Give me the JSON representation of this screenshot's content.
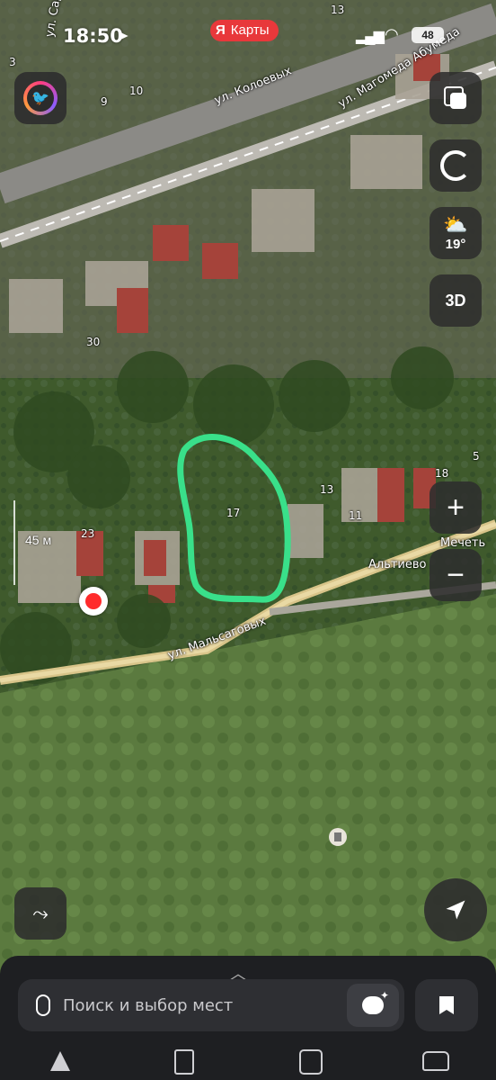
{
  "status_bar": {
    "time": "18:50",
    "battery": "48"
  },
  "app": {
    "brand_logo": "Я",
    "brand_name": "Карты"
  },
  "map": {
    "streets": [
      "ул. Садовая",
      "ул. Колоевых",
      "ул. Магомеда Абумеда",
      "ул. Мальсаговых"
    ],
    "house_numbers": [
      "3",
      "9",
      "10",
      "13",
      "30",
      "17",
      "23",
      "13",
      "11",
      "18",
      "5"
    ],
    "place_label_partial": "Альтиево",
    "poi_label_partial": "Мечеть",
    "scale_label": "45 м",
    "highlight_color": "#39e08a",
    "location_pin_color": "#ff2b2b"
  },
  "controls": {
    "layers": "layers-icon",
    "compass": "compass-icon",
    "weather": {
      "icon": "partly-cloudy-icon",
      "temperature": "19°"
    },
    "view_3d": "3D",
    "zoom_in": "+",
    "zoom_out": "−"
  },
  "bottom_panel": {
    "search_placeholder": "Поиск и выбор мест",
    "tabs": [
      "navigation-icon",
      "fuel-icon",
      "bus-icon",
      "taxi-icon"
    ]
  }
}
